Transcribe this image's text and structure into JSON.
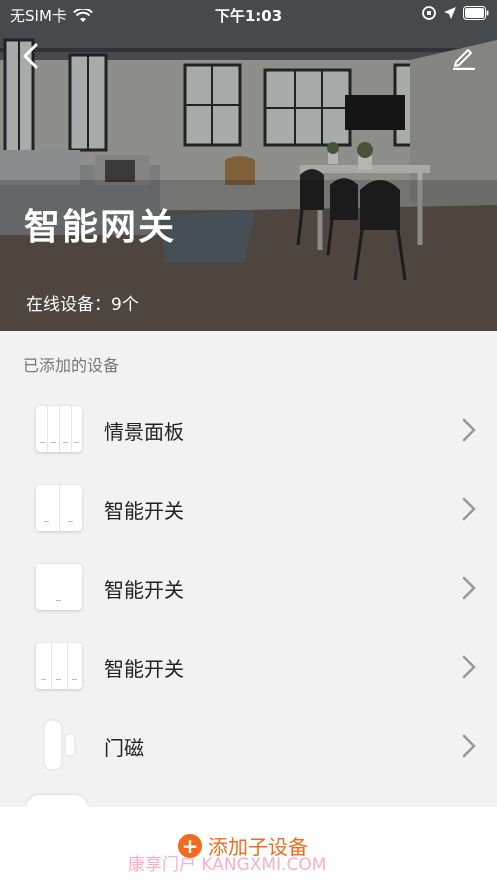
{
  "status_bar": {
    "carrier": "无SIM卡",
    "time": "下午1:03"
  },
  "header": {
    "title": "智能网关",
    "online_devices": "在线设备：9个"
  },
  "section": {
    "label": "已添加的设备"
  },
  "devices": [
    {
      "name": "情景面板",
      "icon": "scene-panel-icon"
    },
    {
      "name": "智能开关",
      "icon": "double-switch-icon"
    },
    {
      "name": "智能开关",
      "icon": "single-switch-icon"
    },
    {
      "name": "智能开关",
      "icon": "triple-switch-icon"
    },
    {
      "name": "门磁",
      "icon": "door-sensor-icon"
    }
  ],
  "footer": {
    "add_button": "添加子设备",
    "watermark": "康享门户 KANGXMI.COM"
  },
  "colors": {
    "accent": "#f26a1b",
    "background": "#f2f2f2"
  }
}
